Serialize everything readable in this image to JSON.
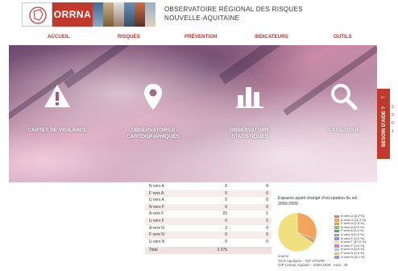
{
  "header": {
    "brand": "ORRNA",
    "org_line1": "OBSERVATOIRE RÉGIONAL DES RISQUES",
    "org_line2": "NOUVELLE-AQUITAINE"
  },
  "nav": {
    "items": [
      {
        "label": "ACCUEIL"
      },
      {
        "label": "RISQUES"
      },
      {
        "label": "PRÉVENTION"
      },
      {
        "label": "INDICATEURS"
      },
      {
        "label": "OUTILS"
      }
    ]
  },
  "hero": {
    "items": [
      {
        "label": "CARTES DE VIGILANCE",
        "icon": "warning-icon"
      },
      {
        "label": "OBSERVATOIRES CARTOGRAPHIQUES",
        "icon": "map-pin-icon"
      },
      {
        "label": "OBSERVATOIRE STATISTIQUES",
        "icon": "bar-chart-icon"
      },
      {
        "label": "CATALOGUE",
        "icon": "search-icon"
      }
    ]
  },
  "help": {
    "label": "BESOIN D'AIDE ?",
    "icon": "arrow-left-icon",
    "edge_marks": [
      "2",
      "9",
      "0",
      "1"
    ]
  },
  "table": {
    "rows": [
      {
        "label": "N vers A",
        "a": "0",
        "b": "0"
      },
      {
        "label": "F vers A",
        "a": "5",
        "b": "0"
      },
      {
        "label": "U vers A",
        "a": "0",
        "b": "0"
      },
      {
        "label": "N vers F",
        "a": "0",
        "b": "0"
      },
      {
        "label": "A vers F",
        "a": "23",
        "b": "1"
      },
      {
        "label": "U vers F",
        "a": "0",
        "b": "0"
      },
      {
        "label": "A vers N",
        "a": "2",
        "b": "0"
      },
      {
        "label": "F vers N",
        "a": "0",
        "b": "0"
      },
      {
        "label": "U vers N",
        "a": "0",
        "b": "0"
      }
    ],
    "total": {
      "label": "Total",
      "a": "2 276",
      "b": ""
    }
  },
  "chart_data": {
    "type": "pie",
    "title": "Espaces ayant changé d'occupation du sol",
    "subtitle": "2000-2009",
    "source_label": "source",
    "source_line1": "OCS Aquitaine · GIP ATGeRi",
    "source_line2": "GIP Littoral Aquitain · 2000-2009 · total : 49",
    "slices": [
      {
        "name": "N vers U (0,0 %)",
        "value": 0.0,
        "color": "#e07b7b"
      },
      {
        "name": "A vers U (22,3 %)",
        "value": 22.3,
        "color": "#f2a45c"
      },
      {
        "name": "F vers U (2,5 %)",
        "value": 2.5,
        "color": "#c9a36b"
      },
      {
        "name": "N vers A (0,0 %)",
        "value": 0.0,
        "color": "#8fbf6a"
      },
      {
        "name": "F vers A (0,0 %)",
        "value": 0.0,
        "color": "#5aa65a"
      },
      {
        "name": "U vers A (0,0 %)",
        "value": 0.0,
        "color": "#a0a0a0"
      },
      {
        "name": "N vers F (0,0 %)",
        "value": 0.0,
        "color": "#7a9fd6"
      },
      {
        "name": "A vers F (47,0 %)",
        "value": 47.0,
        "color": "#f0e080"
      },
      {
        "name": "U vers F (0,0 %)",
        "value": 0.0,
        "color": "#d67fbf"
      },
      {
        "name": "A vers N (0,0 %)",
        "value": 0.0,
        "color": "#9fd0e0"
      },
      {
        "name": "F vers N (0,0 %)",
        "value": 0.0,
        "color": "#c0d070"
      },
      {
        "name": "U vers N (0,0 %)",
        "value": 0.0,
        "color": "#b090d0"
      }
    ]
  }
}
